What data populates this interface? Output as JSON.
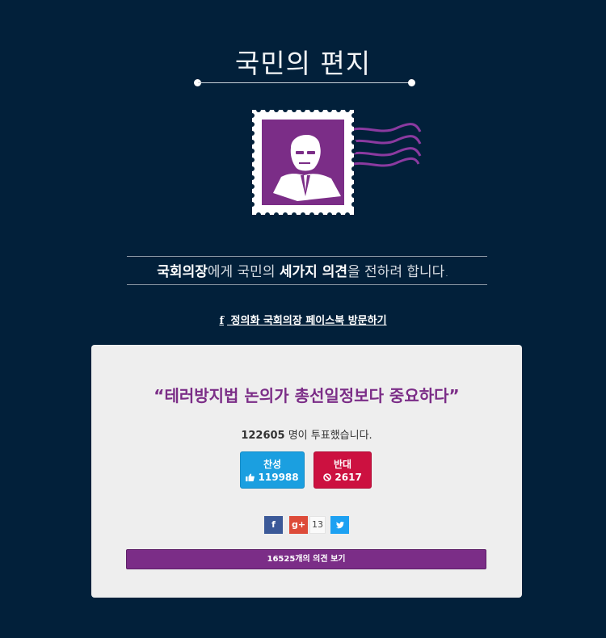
{
  "header": {
    "title": "국민의 편지"
  },
  "tagline": {
    "part1": "국회의장",
    "part2": "에게 국민의 ",
    "part3": "세가지 의견",
    "part4": "을 전하려 합니다."
  },
  "facebook_link": {
    "icon": "f",
    "label": " 정의화 국회의장 페이스북 방문하기"
  },
  "card": {
    "quote": "“테러방지법 논의가 총선일정보다 중요하다”",
    "vote_total": "122605",
    "vote_suffix": " 명이 투표했습니다.",
    "agree": {
      "label": "찬성",
      "count": "119988",
      "icon": "thumbs-up-icon"
    },
    "disagree": {
      "label": "반대",
      "count": "2617",
      "icon": "ban-icon"
    },
    "share": {
      "facebook": "f",
      "google": "g+",
      "count": "13",
      "twitter": "twitter-icon"
    },
    "opinions_button": "16525개의 의견 보기"
  },
  "colors": {
    "background": "#02203a",
    "card": "#eeeeee",
    "purple": "#7b2d87",
    "agree": "#1b9fe0",
    "disagree": "#cc1140"
  }
}
